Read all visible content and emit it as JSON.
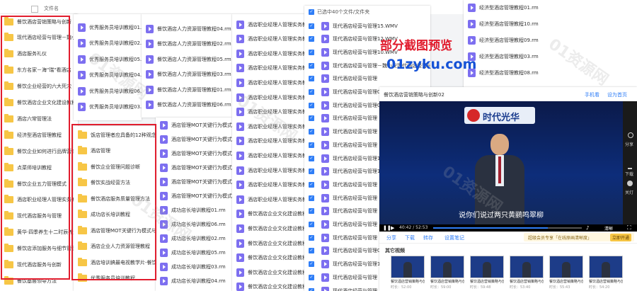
{
  "header": {
    "column_label": "文件名"
  },
  "colors": {
    "highlight": "#e11d2e",
    "folder": "#f7c646",
    "video_icon": "#7d6ff0",
    "check": "#2f7ef7",
    "promo_red": "#e11d2e",
    "promo_blue": "#1451d6"
  },
  "col1": {
    "items": [
      "餐饮酒店营销策略与创新",
      "现代酒店经营与管理－魏小安",
      "酒店服务礼仪",
      "东方名家－海\"瑞\"看酒店",
      "餐饮企业经营的六大死穴",
      "餐饮酒店企业文化建设教程",
      "酒店六常管理法",
      "经济型酒店管理教程",
      "餐饮企业如何进行品牌营销",
      "点菜师培训教程",
      "餐饮企业五力管理模式",
      "酒店职业经理人管理实务教程",
      "现代酒店服务与管理",
      "黄华·四季养生十二时辰养生",
      "餐饮店添加服务与细节管理",
      "现代酒店服务与创新",
      "餐饮基层领导方法"
    ]
  },
  "col2": {
    "items": [
      "优秀服务员培训教程01.rm",
      "优秀服务员培训教程02.rm",
      "优秀服务员培训教程05.rm",
      "优秀服务员培训教程04.rm",
      "优秀服务员培训教程06.rm",
      "优秀服务员培训教程03.rm"
    ]
  },
  "col2b": {
    "items": [
      "饭店管理者应具备的12种观念与理念",
      "酒店管理",
      "餐饮企业管理问题诊断",
      "餐饮实战经营方法",
      "餐饮酒店服务质量管理方法",
      "成功店长培训教程",
      "酒店管理MOT关键行为模式与客服技巧RM",
      "酒店企业人力资源管理教程",
      "酒店培训搞最电视教学片-餐饮娱乐篇",
      "优秀服务员培训教程"
    ]
  },
  "col3": {
    "items": [
      "餐饮酒店人力资源管理教程04.rm",
      "餐饮酒店人力资源管理教程02.rm",
      "餐饮酒店人力资源管理教程05.rm",
      "餐饮酒店人力资源管理教程03.rm",
      "餐饮酒店人力资源管理教程01.rm",
      "餐饮酒店人力资源管理教程06.rm"
    ]
  },
  "col3b": {
    "items": [
      "酒店管理MOT关键行为模式与客服",
      "酒店管理MOT关键行为模式与客服",
      "酒店管理MOT关键行为模式与客服",
      "酒店管理MOT关键行为模式与客服",
      "酒店管理MOT关键行为模式与客服",
      "酒店管理MOT关键行为模式与客服",
      "成功店长培训教程01.rm",
      "成功店长培训教程06.rm",
      "成功店长培训教程02.rm",
      "成功店长培训教程05.rm",
      "成功店长培训教程03.rm",
      "成功店长培训教程04.rm"
    ]
  },
  "col4": {
    "items": [
      "酒店职业经理人管理实务教程",
      "酒店职业经理人管理实务教程",
      "酒店职业经理人管理实务教程10",
      "酒店职业经理人管理实务教程11",
      "酒店职业经理人管理实务教程12",
      "酒店职业经理人管理实务教程05",
      "酒店职业经理人管理实务教程07",
      "酒店职业经理人管理实务教程04",
      "酒店职业经理人管理实务教程02",
      "酒店职业经理人管理实务教程01",
      "酒店职业经理人管理实务教程06",
      "酒店职业经理人管理实务教程08",
      "酒店职业经理人管理实务教程09",
      "餐饮酒店企业文化建设教程01",
      "餐饮酒店企业文化建设教程02",
      "餐饮酒店企业文化建设教程03",
      "餐饮酒店企业文化建设教程04",
      "餐饮酒店企业文化建设教程05",
      "餐饮酒店企业文化建设教程06"
    ]
  },
  "col5": {
    "selection_text": "已选中40个文件/文件夹",
    "items": [
      "现代酒店经营与管理15.WMV",
      "现代酒店经营与管理12.WMV",
      "现代酒店经营与管理10.WMV",
      "现代酒店经营与管理－魏小安现代酒店经营与管理",
      "现代酒店经营与管理",
      "现代酒店经营与管理01.WMV",
      "现代酒店经营与管理02.WMV",
      "现代酒店经营与管理",
      "现代酒店经营与管理",
      "现代酒店经营与管理",
      "现代酒店经营与管理19.WMV",
      "现代酒店经营与管理17.WMV",
      "现代酒店经营与管理",
      "现代酒店经营与管理",
      "现代酒店经营与管理",
      "现代酒店经营与管理",
      "现代酒店经营与管理",
      "现代酒店经营与管理01.WMV",
      "现代酒店经营与管理14.WMV",
      "现代酒店经营与管理",
      "现代酒店经营与管理"
    ]
  },
  "col6": {
    "items": [
      "经济型酒店管理教程01.rm",
      "经济型酒店管理教程10.rm",
      "经济型酒店管理教程09.rm",
      "经济型酒店管理教程03.rm",
      "经济型酒店管理教程08.rm"
    ]
  },
  "promo": {
    "title": "部分截图预览",
    "site": "01zyku.com"
  },
  "watermark": "01资源网",
  "player": {
    "title": "餐饮酒店营销策略与创新02",
    "top_right": [
      "手机看",
      "设为首页"
    ],
    "brand": "时代光华",
    "subtitle": "说你们说过两只黄鹂鸣翠柳",
    "time": "40:42 / 52:53",
    "quality": "清晰",
    "side_tools": [
      "分享",
      "下载",
      "关灯"
    ],
    "actions": [
      "分享",
      "下载",
      "转存",
      "设置笔记"
    ],
    "vip_text": "超级会员专享「在线原画清晰度」",
    "vip_button": "立即开通",
    "other_videos_label": "其它视频",
    "thumbs": [
      "餐饮酒店营销策略与创",
      "餐饮酒店营销策略与创",
      "餐饮酒店营销策略与创",
      "餐饮酒店营销策略与创",
      "餐饮酒店营销策略与创",
      "餐饮酒店营销策略与创"
    ],
    "thumb_meta": [
      "时长：52:00",
      "时长：59:00",
      "时长：59:48",
      "时长：53:40",
      "时长：55:43",
      "时长：54:20"
    ]
  }
}
